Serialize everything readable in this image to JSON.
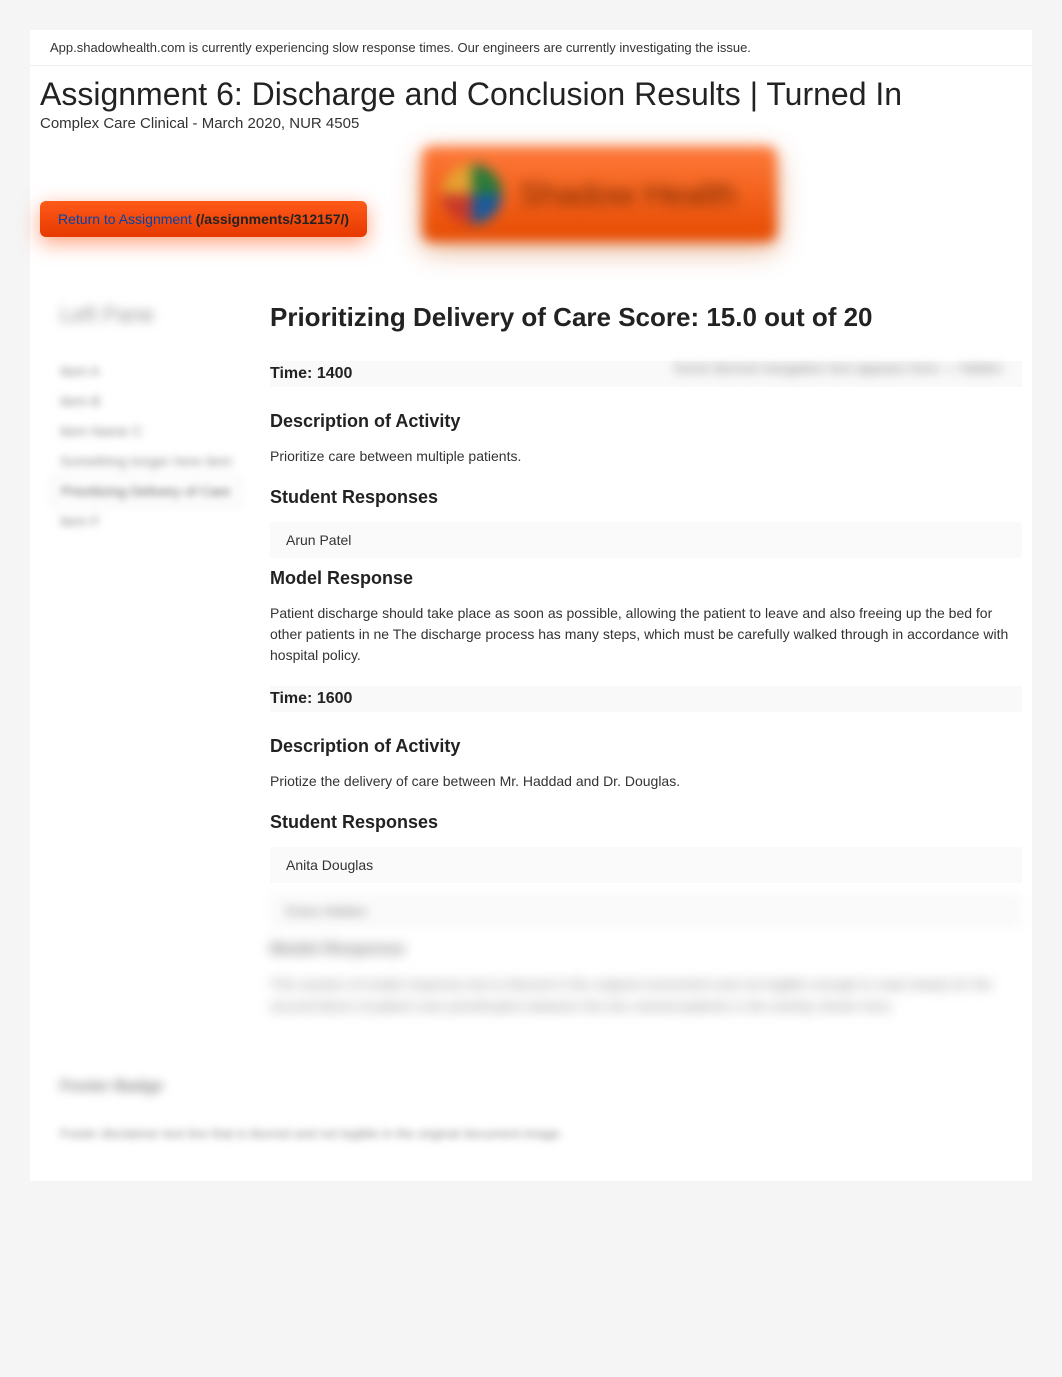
{
  "alert": "App.shadowhealth.com is currently experiencing slow response times. Our engineers are currently investigating the issue.",
  "title": "Assignment 6: Discharge and Conclusion Results | Turned In",
  "course": "Complex Care Clinical - March 2020, NUR 4505",
  "return_button": {
    "link_text": "Return to Assignment",
    "path_text": " (/assignments/312157/)"
  },
  "logo_text": "Shadow Health",
  "sidebar": {
    "title": "Left Pane",
    "items": [
      "Item A",
      "Item B",
      "Item Name C",
      "Something longer here item",
      "Prioritizing Delivery of Care",
      "Item F"
    ],
    "active_index": 4
  },
  "top_right": "Some blurred navigation text appears here — hidden",
  "main": {
    "score_title": "Prioritizing Delivery of Care Score: 15.0 out of 20",
    "blocks": [
      {
        "time": "Time: 1400",
        "desc_heading": "Description of Activity",
        "desc_text": "Prioritize care between multiple patients.",
        "resp_heading": "Student Responses",
        "responses": [
          "Arun Patel"
        ],
        "model_heading": "Model Response",
        "model_text": "Patient discharge should take place as soon as possible, allowing the patient to leave and also freeing up the bed for other patients in ne The discharge process has many steps, which must be carefully walked through in accordance with hospital policy."
      },
      {
        "time": "Time: 1600",
        "desc_heading": "Description of Activity",
        "desc_text": "Priotize the delivery of care between Mr. Haddad and Dr. Douglas.",
        "resp_heading": "Student Responses",
        "responses": [
          "Anita Douglas",
          "Extra Hidden"
        ],
        "model_heading": "Model Response",
        "model_text": "This section of model response text is blurred in the original screenshot and not legible enough to read clearly for the second block of patient care prioritization between the two named patients in the activity shown here."
      }
    ]
  },
  "footer": {
    "badge": "Footer Badge",
    "text": "Footer disclaimer text line that is blurred and not legible in the original document image."
  }
}
